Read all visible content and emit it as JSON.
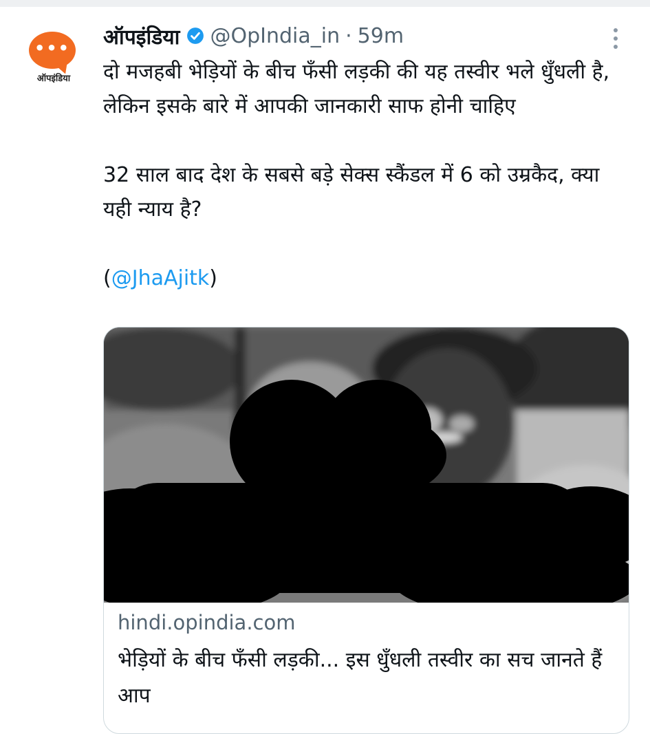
{
  "account": {
    "avatar_label": "ऑपइंडिया",
    "avatar_dots": "•••",
    "display_name": "ऑपइंडिया",
    "handle": "@OpIndia_in",
    "separator": "·",
    "time": "59m",
    "brand_color": "#f26b21"
  },
  "tweet": {
    "paragraph_1": "दो मजहबी भेड़ियों के बीच फँसी लड़की की यह तस्वीर भले धुँधली है, लेकिन इसके बारे में आपकी जानकारी साफ होनी चाहिए",
    "paragraph_2": "32 साल बाद देश के सबसे बड़े सेक्स स्कैंडल में 6 को उम्रकैद, क्या यही न्याय है?",
    "credit_open": "(",
    "mention": "@JhaAjitk",
    "credit_close": ")",
    "mention_color": "#1d9bf0"
  },
  "card": {
    "domain": "hindi.opindia.com",
    "title": "भेड़ियों के बीच फँसी लड़की... इस धुँधली तस्वीर का सच जानते हैं आप"
  },
  "icons": {
    "verified": "verified-badge-icon",
    "more": "more-options-icon"
  }
}
